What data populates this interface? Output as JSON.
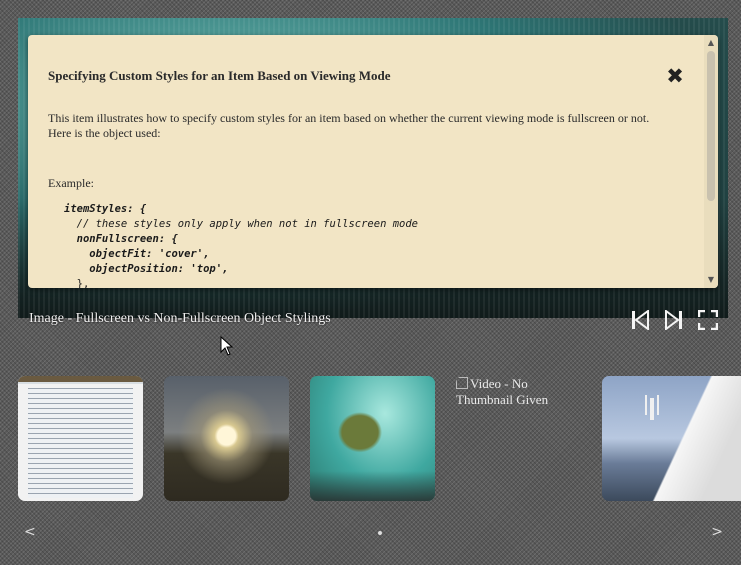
{
  "popup": {
    "title": "Specifying Custom Styles for an Item Based on Viewing Mode",
    "close_icon": "✖",
    "description": "This item illustrates how to specify custom styles for an item based on whether the current viewing mode is fullscreen or not. Here is the object used:",
    "example_label": "Example:",
    "code_lines": [
      "itemStyles: {",
      "  // these styles only apply when not in fullscreen mode",
      "  nonFullscreen: {",
      "    objectFit: 'cover',",
      "    objectPosition: 'top',",
      "  },"
    ]
  },
  "caption": {
    "text": "Image - Fullscreen vs Non-Fullscreen Object Stylings"
  },
  "controls": {
    "prev_icon": "skip-previous-icon",
    "next_icon": "skip-next-icon",
    "fullscreen_icon": "fullscreen-icon"
  },
  "thumbnails": [
    {
      "name": "document-screenshot-thumbnail",
      "alt": ""
    },
    {
      "name": "sunset-thumbnail",
      "alt": ""
    },
    {
      "name": "sea-turtle-thumbnail",
      "alt": ""
    },
    {
      "name": "video-thumbnail",
      "alt": "Video - No Thumbnail Given"
    },
    {
      "name": "cliff-jump-thumbnail",
      "alt": ""
    }
  ],
  "nav": {
    "prev": "<",
    "next": ">"
  }
}
